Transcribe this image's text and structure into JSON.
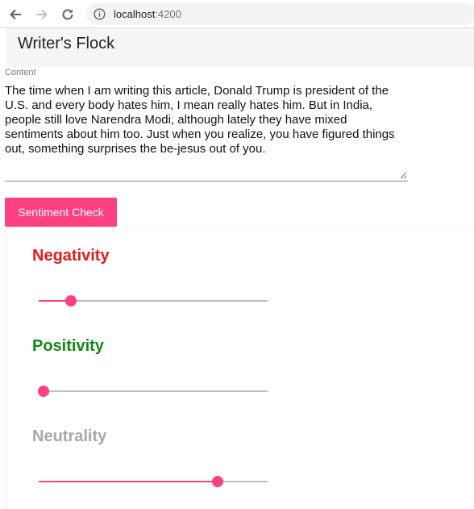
{
  "browser": {
    "url_host": "localhost",
    "url_port": ":4200"
  },
  "app": {
    "title": "Writer's Flock"
  },
  "form": {
    "content_label": "Content",
    "content_value": "The time when I am writing this article, Donald Trump is president of the U.S. and every body hates him, I mean really hates him. But in India, people still love Narendra Modi, although lately they have mixed sentiments about him too. Just when you realize, you have figured things out, something surprises the be-jesus out of you.",
    "button_label": "Sentiment Check"
  },
  "results": {
    "negativity": {
      "label": "Negativity",
      "color": "#e31c1c",
      "value": 0.14
    },
    "positivity": {
      "label": "Positivity",
      "color": "#118a11",
      "value": 0.02
    },
    "neutrality": {
      "label": "Neutrality",
      "color": "#a8a8a8",
      "value": 0.78
    }
  },
  "accent_color": "#ff4081"
}
